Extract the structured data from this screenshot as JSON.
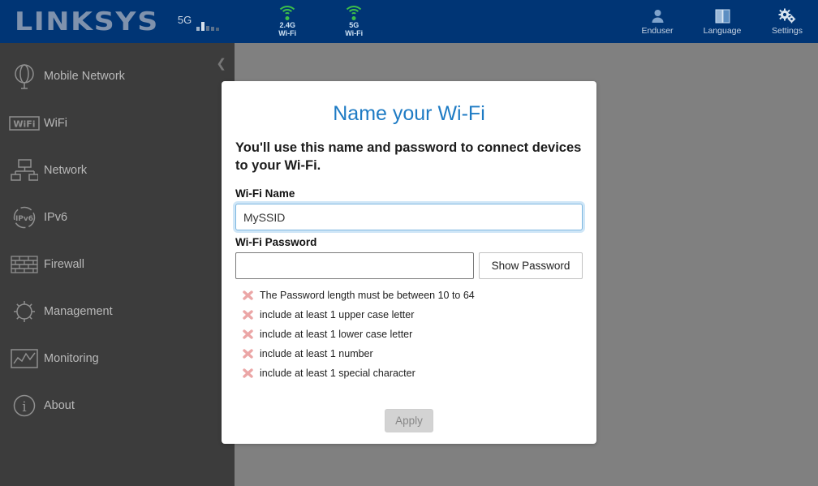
{
  "header": {
    "brand": "LINKSYS",
    "mobile_network_label": "5G",
    "signal_icon": "signal-bars-icon",
    "wifi_badges": [
      {
        "icon": "wifi-signal-icon",
        "line1": "2.4G",
        "line2": "Wi-Fi"
      },
      {
        "icon": "wifi-signal-icon",
        "line1": "5G",
        "line2": "Wi-Fi"
      }
    ],
    "right_items": [
      {
        "label": "Enduser",
        "icon": "user-icon"
      },
      {
        "label": "Language",
        "icon": "language-book-icon"
      },
      {
        "label": "Settings",
        "icon": "gears-icon"
      }
    ],
    "background_color": "#003575"
  },
  "sidebar": {
    "background_color": "#3c3c3c",
    "collapse_icon": "chevron-left-icon",
    "items": [
      {
        "label": "Mobile Network",
        "icon": "globe-icon"
      },
      {
        "label": "WiFi",
        "icon": "wifi-box-icon"
      },
      {
        "label": "Network",
        "icon": "network-topology-icon"
      },
      {
        "label": "IPv6",
        "icon": "ipv6-circle-icon"
      },
      {
        "label": "Firewall",
        "icon": "firewall-brick-icon"
      },
      {
        "label": "Management",
        "icon": "gear-icon"
      },
      {
        "label": "Monitoring",
        "icon": "chart-line-icon"
      },
      {
        "label": "About",
        "icon": "info-circle-icon"
      }
    ]
  },
  "modal": {
    "title": "Name your Wi-Fi",
    "title_color": "#1e7bc4",
    "subtitle": "You'll use this name and password to connect devices to your Wi-Fi.",
    "ssid_label": "Wi-Fi Name",
    "ssid_value": "MySSID",
    "ssid_placeholder": "",
    "password_label": "Wi-Fi Password",
    "password_value": "",
    "password_placeholder": "",
    "show_password_label": "Show Password",
    "rules_icon": "red-x-icon",
    "rules_icon_color": "#e8a0a0",
    "rules": [
      "The Password length must be between 10 to 64",
      "include at least 1 upper case letter",
      "include at least 1 lower case letter",
      "include at least 1 number",
      "include at least 1 special character"
    ],
    "apply_label": "Apply",
    "apply_disabled": true
  },
  "page": {
    "overlay_color": "#808080"
  }
}
